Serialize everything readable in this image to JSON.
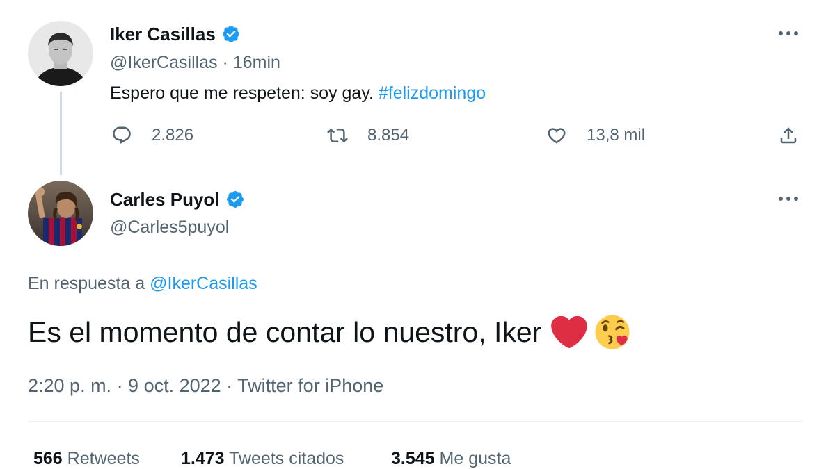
{
  "tweet1": {
    "author_name": "Iker Casillas",
    "handle": "@IkerCasillas",
    "separator": "·",
    "time": "16min",
    "text_plain": "Espero que me respeten: soy gay.",
    "hashtag": "#felizdomingo",
    "more_icon": "more-horizontal-icon",
    "actions": {
      "replies": "2.826",
      "retweets": "8.854",
      "likes": "13,8 mil"
    }
  },
  "tweet2": {
    "author_name": "Carles Puyol",
    "handle": "@Carles5puyol",
    "more_icon": "more-horizontal-icon",
    "reply_prefix": "En respuesta a",
    "reply_handle": "@IkerCasillas",
    "text": "Es el momento de contar lo nuestro, Iker",
    "emojis": [
      "red-heart-icon",
      "face-blowing-kiss-icon"
    ],
    "meta": "2:20 p. m. · 9 oct. 2022 · Twitter for iPhone",
    "stats": [
      {
        "count": "566",
        "label": "Retweets"
      },
      {
        "count": "1.473",
        "label": "Tweets citados"
      },
      {
        "count": "3.545",
        "label": "Me gusta"
      }
    ]
  },
  "colors": {
    "accent": "#1d9bf0",
    "secondary_text": "#536471",
    "primary_text": "#0f1419",
    "divider": "#eff3f4",
    "heart_red": "#dd2e44"
  }
}
